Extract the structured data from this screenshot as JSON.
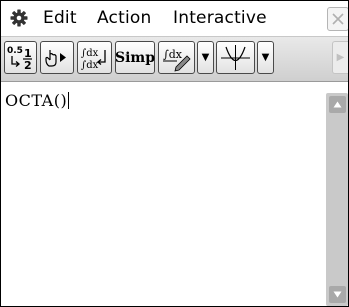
{
  "menu": {
    "items": [
      "Edit",
      "Action",
      "Interactive"
    ]
  },
  "toolbar": {
    "simp_label": "Simp"
  },
  "editor": {
    "text": "OCTA()"
  },
  "icons": {
    "gear": "gear-icon",
    "close": "close-icon",
    "fraction_decimal": "fraction-decimal-icon",
    "hand_arrow": "hand-arrow-icon",
    "integral_toggle": "integral-toggle-icon",
    "integral_edit": "integral-pencil-icon",
    "graph": "graph-icon",
    "dropdown": "triangle-down-icon",
    "scroll_up": "triangle-up-icon",
    "scroll_down": "triangle-down-icon",
    "next": "triangle-right-icon"
  }
}
